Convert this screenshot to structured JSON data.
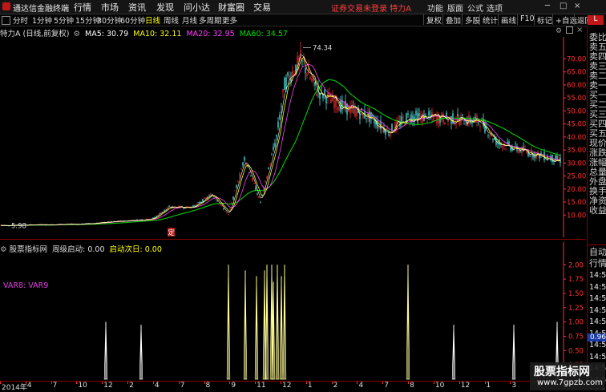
{
  "app": {
    "title": "通达信金融终端"
  },
  "main_menu": [
    "行情",
    "市场",
    "资讯",
    "发现",
    "问小达",
    "财富圈",
    "交易"
  ],
  "notice": "证券交易未登录  特力A",
  "right_menu": [
    "功能",
    "版面",
    "公式",
    "选项"
  ],
  "window_buttons": [
    "─",
    "□",
    "×"
  ],
  "toolbar": {
    "timeframes": [
      "分时",
      "1分钟",
      "5分钟",
      "15分钟",
      "30分钟",
      "60分钟",
      "日线",
      "周线",
      "月线",
      "多周期",
      "更多"
    ],
    "active": "日线",
    "buttons": [
      "复权",
      "叠加",
      "多股",
      "统计",
      "画线",
      "F10",
      "标记",
      "+自选",
      "返回"
    ]
  },
  "info": {
    "stock": "特力A (日线,前复权)",
    "ma5": "MA5: 30.79",
    "ma10": "MA10: 32.11",
    "ma20": "MA20: 32.95",
    "ma60": "MA60: 34.57"
  },
  "colors": {
    "ma5": "#ffffff",
    "ma10": "#ffff00",
    "ma20": "#ff40ff",
    "ma60": "#00e000",
    "up": "#ff3232",
    "down": "#54ffff",
    "axis": "#ff3030",
    "signal_yellow": "#fffb96",
    "signal_white": "#ffffff"
  },
  "chart_data": [
    {
      "type": "candlestick",
      "title": "特力A (日线,前复权)",
      "y_ticks": [
        "70.00",
        "65.00",
        "60.00",
        "55.00",
        "50.00",
        "45.00",
        "40.00",
        "35.00",
        "30.00",
        "25.00",
        "20.00",
        "15.00",
        "10.00"
      ],
      "ylim": [
        3,
        76
      ],
      "annotations": {
        "high": "74.34",
        "low": "5.98",
        "marker": "定"
      },
      "x_month_labels": [
        "2014年",
        "4",
        "7",
        "10",
        "12",
        "2",
        "4",
        "7",
        "8",
        "9",
        "11",
        "12",
        "1",
        "2",
        "4",
        "7",
        "8",
        "10",
        "12",
        "1",
        "3",
        "4"
      ],
      "approx_close_path": [
        [
          0,
          6.0
        ],
        [
          100,
          6.5
        ],
        [
          190,
          8.5
        ],
        [
          210,
          13
        ],
        [
          240,
          13
        ],
        [
          265,
          18
        ],
        [
          285,
          10
        ],
        [
          305,
          32
        ],
        [
          325,
          15
        ],
        [
          345,
          40
        ],
        [
          355,
          60
        ],
        [
          375,
          70
        ],
        [
          395,
          58
        ],
        [
          425,
          52
        ],
        [
          460,
          48
        ],
        [
          485,
          42
        ],
        [
          510,
          48
        ],
        [
          560,
          47
        ],
        [
          600,
          46
        ],
        [
          620,
          38
        ],
        [
          660,
          34
        ],
        [
          700,
          31
        ]
      ]
    },
    {
      "type": "bar",
      "title": "股票指标网 周级启动",
      "series": [
        {
          "name": "周级启动",
          "values": [
            "0.00"
          ]
        },
        {
          "name": "启动次日",
          "values": [
            "0.00"
          ]
        }
      ],
      "y_ticks": [
        "2.00",
        "1.75",
        "1.50",
        "1.25",
        "1.00",
        "0.75",
        "0.50",
        "0.25"
      ],
      "ylim": [
        0,
        2.2
      ],
      "spikes_yellow": [
        [
          285,
          2.0
        ],
        [
          306,
          1.9
        ],
        [
          320,
          1.8
        ],
        [
          330,
          1.9
        ],
        [
          333,
          2.0
        ],
        [
          339,
          2.0
        ],
        [
          341,
          1.7
        ],
        [
          346,
          2.0
        ],
        [
          351,
          1.8
        ],
        [
          355,
          2.0
        ],
        [
          509,
          2.0
        ]
      ],
      "spikes_white": [
        [
          132,
          1.0
        ],
        [
          176,
          0.95
        ],
        [
          566,
          0.95
        ],
        [
          641,
          0.95
        ],
        [
          695,
          1.0
        ]
      ]
    }
  ],
  "indicator": {
    "name": "股票指标网",
    "weekly": "周级启动: 0.00",
    "nextday": "启动次日: 0.00",
    "var_label": "VAR8: VAR9",
    "value_badge": "0.96"
  },
  "right_panel": {
    "header": "L",
    "items": [
      "委比",
      "卖五",
      "卖四",
      "卖三",
      "卖二",
      "卖一",
      "买一",
      "买二",
      "买三",
      "买四",
      "买五",
      "现价",
      "涨跌",
      "涨幅",
      "总量",
      "外盘",
      "换手",
      "净资",
      "收益"
    ],
    "auto_label": "自动",
    "market_label": "行情",
    "times": [
      "14:5",
      "14:5",
      "14:5",
      "14:5",
      "14:5",
      "14:5",
      "14:5",
      "14:5",
      "14:5",
      "14:5",
      "14:5"
    ]
  },
  "watermark": {
    "line1": "股票指标网",
    "line2": "www.7gpzb.com"
  }
}
